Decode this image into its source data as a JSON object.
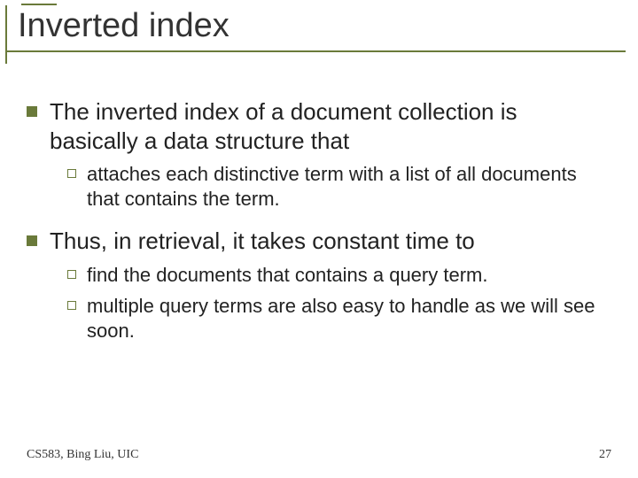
{
  "title": "Inverted index",
  "bullets": {
    "p1": "The inverted index of a document collection is basically a data structure that",
    "p1_sub1": "attaches each distinctive term with a list of all documents that contains the term.",
    "p2": "Thus, in retrieval, it takes constant time to",
    "p2_sub1": "find the documents that contains a query term.",
    "p2_sub2": "multiple query terms are also easy to handle as we will see soon."
  },
  "footer": {
    "left": "CS583, Bing Liu, UIC",
    "right": "27"
  }
}
